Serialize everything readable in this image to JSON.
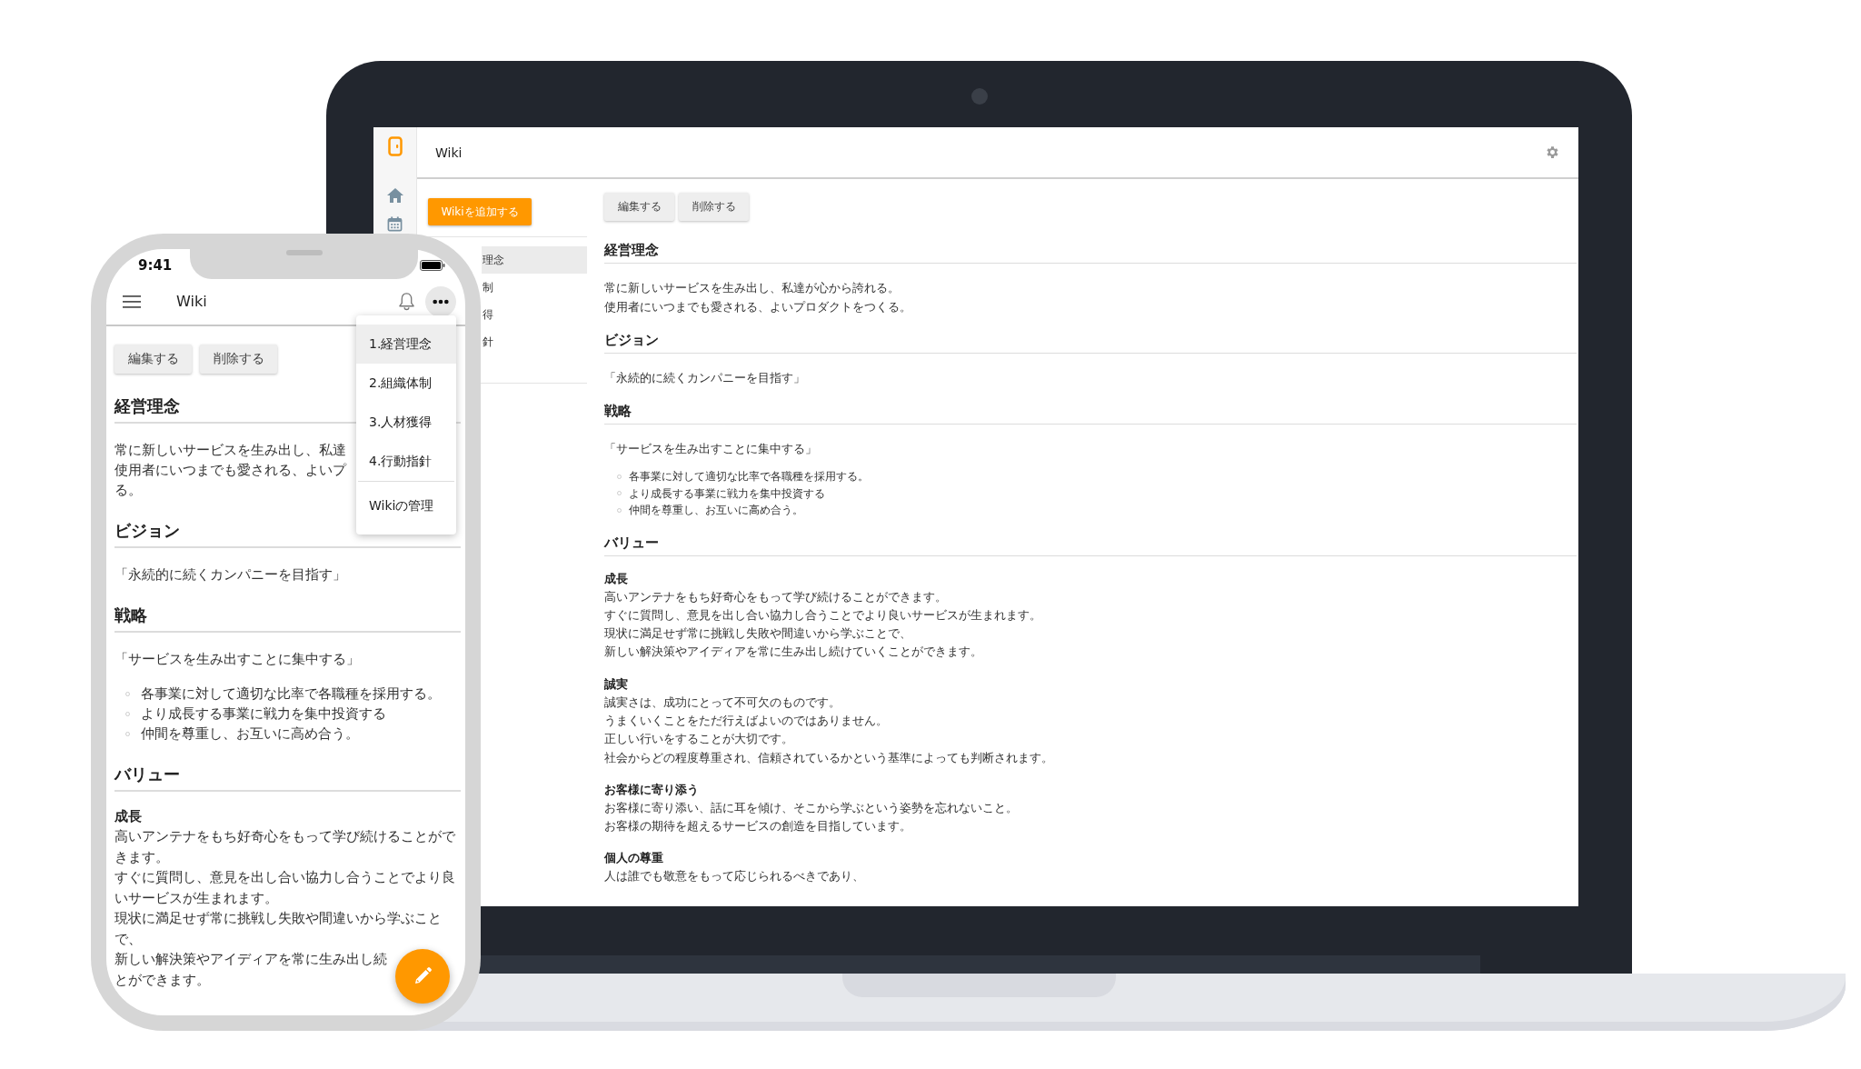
{
  "laptop": {
    "app_bar": {
      "title": "Wiki"
    },
    "side_panel": {
      "add_button": "Wikiを追加する",
      "items": [
        {
          "label": "理念",
          "selected": true
        },
        {
          "label": "制",
          "selected": false
        },
        {
          "label": "得",
          "selected": false
        },
        {
          "label": "針",
          "selected": false
        }
      ]
    },
    "buttons": [
      "編集する",
      "削除する"
    ],
    "sections": [
      {
        "heading": "経営理念",
        "blocks": [
          {
            "kind": "para",
            "lines": [
              "常に新しいサービスを生み出し、私達が心から誇れる。",
              "使用者にいつまでも愛される、よいプロダクトをつくる。"
            ]
          }
        ]
      },
      {
        "heading": "ビジョン",
        "blocks": [
          {
            "kind": "para",
            "lines": [
              "「永続的に続くカンパニーを目指す」"
            ]
          }
        ]
      },
      {
        "heading": "戦略",
        "blocks": [
          {
            "kind": "para",
            "lines": [
              "「サービスを生み出すことに集中する」"
            ]
          },
          {
            "kind": "list",
            "items": [
              "各事業に対して適切な比率で各職種を採用する。",
              "より成長する事業に戦力を集中投資する",
              "仲間を尊重し、お互いに高め合う。"
            ]
          }
        ]
      },
      {
        "heading": "バリュー",
        "blocks": [
          {
            "kind": "sub",
            "title": "成長",
            "lines": [
              "高いアンテナをもち好奇心をもって学び続けることができます。",
              "すぐに質問し、意見を出し合い協力し合うことでより良いサービスが生まれます。",
              "現状に満足せず常に挑戦し失敗や間違いから学ぶことで、",
              "新しい解決策やアイディアを常に生み出し続けていくことができます。"
            ]
          },
          {
            "kind": "sub",
            "title": "誠実",
            "lines": [
              "誠実さは、成功にとって不可欠のものです。",
              "うまくいくことをただ行えばよいのではありません。",
              "正しい行いをすることが大切です。",
              "社会からどの程度尊重され、信頼されているかという基準によっても判断されます。"
            ]
          },
          {
            "kind": "sub",
            "title": "お客様に寄り添う",
            "lines": [
              "お客様に寄り添い、話に耳を傾け、そこから学ぶという姿勢を忘れないこと。",
              "お客様の期待を超えるサービスの創造を目指しています。"
            ]
          },
          {
            "kind": "sub",
            "title": "個人の尊重",
            "lines": [
              "人は誰でも敬意をもって応じられるべきであり、"
            ]
          }
        ]
      }
    ]
  },
  "phone": {
    "status_bar": {
      "time": "9:41"
    },
    "app_bar": {
      "title": "Wiki"
    },
    "buttons": [
      "編集する",
      "削除する"
    ],
    "sections": [
      {
        "heading": "経営理念",
        "blocks": [
          {
            "kind": "para",
            "lines": [
              "常に新しいサービスを生み出し、私達",
              "使用者にいつまでも愛される、よいプ",
              "る。"
            ]
          }
        ]
      },
      {
        "heading": "ビジョン",
        "blocks": [
          {
            "kind": "para",
            "lines": [
              "「永続的に続くカンパニーを目指す」"
            ]
          }
        ]
      },
      {
        "heading": "戦略",
        "blocks": [
          {
            "kind": "para",
            "lines": [
              "「サービスを生み出すことに集中する」"
            ]
          },
          {
            "kind": "list",
            "items": [
              "各事業に対して適切な比率で各職種を採用する。",
              "より成長する事業に戦力を集中投資する",
              "仲間を尊重し、お互いに高め合う。"
            ]
          }
        ]
      },
      {
        "heading": "バリュー",
        "blocks": [
          {
            "kind": "sub",
            "title": "成長",
            "lines": [
              "高いアンテナをもち好奇心をもって学び続けることがで",
              "きます。",
              "すぐに質問し、意見を出し合い協力し合うことでより良",
              "いサービスが生まれます。",
              "現状に満足せず常に挑戦し失敗や間違いから学ぶこと",
              "で、",
              "新しい解決策やアイディアを常に生み出し続",
              "とができます。"
            ]
          }
        ]
      }
    ],
    "menu": {
      "pages": [
        {
          "label": "1.経営理念",
          "selected": true
        },
        {
          "label": "2.組織体制",
          "selected": false
        },
        {
          "label": "3.人材獲得",
          "selected": false
        },
        {
          "label": "4.行動指針",
          "selected": false
        }
      ],
      "manage": "Wikiの管理"
    }
  }
}
